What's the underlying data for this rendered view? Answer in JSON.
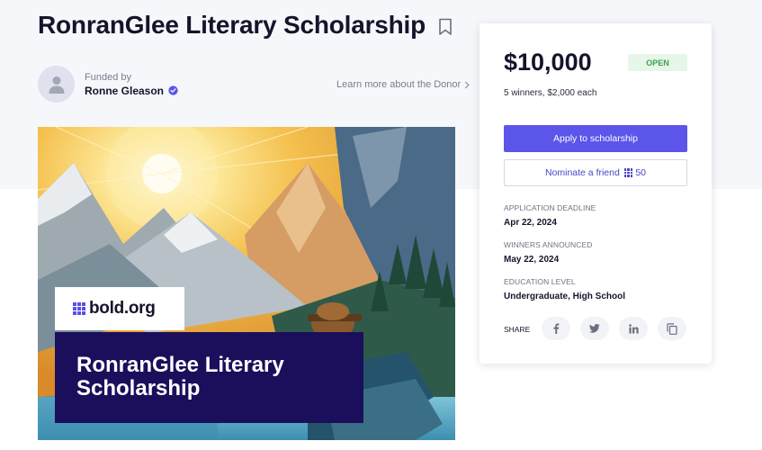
{
  "page": {
    "title": "RonranGlee Literary Scholarship"
  },
  "funder": {
    "funded_by_label": "Funded by",
    "name": "Ronne Gleason",
    "learn_more": "Learn more about the Donor"
  },
  "hero": {
    "logo_text": "bold.org",
    "banner_title": "RonranGlee Literary Scholarship"
  },
  "card": {
    "amount": "$10,000",
    "status": "OPEN",
    "winners": "5 winners, $2,000 each",
    "apply_label": "Apply to scholarship",
    "nominate_label": "Nominate a friend",
    "nominate_points": "50",
    "details": [
      {
        "label": "APPLICATION DEADLINE",
        "value": "Apr 22, 2024"
      },
      {
        "label": "WINNERS ANNOUNCED",
        "value": "May 22, 2024"
      },
      {
        "label": "EDUCATION LEVEL",
        "value": "Undergraduate, High School"
      }
    ],
    "share_label": "SHARE",
    "share_icons": [
      "facebook-icon",
      "twitter-icon",
      "linkedin-icon",
      "copy-link-icon"
    ]
  },
  "colors": {
    "accent": "#5b55ea",
    "banner": "#1b0f5c",
    "status_green": "#3aa255",
    "band": "#f6f7fa"
  }
}
